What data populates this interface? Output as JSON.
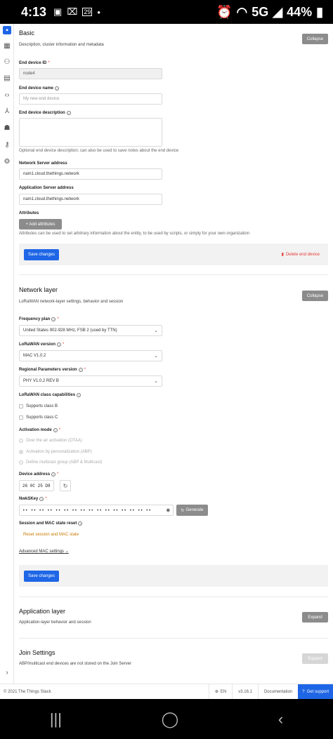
{
  "status_bar": {
    "time": "4:13",
    "network": "5G",
    "battery": "44%",
    "calendar_day": "29"
  },
  "sidebar": {
    "expand_icon": "chevron-right"
  },
  "basic": {
    "title": "Basic",
    "description": "Description, cluster information and metadata",
    "collapse_label": "Collapse",
    "end_device_id": {
      "label": "End device ID",
      "value": "node4"
    },
    "end_device_name": {
      "label": "End device name",
      "placeholder": "My new end device"
    },
    "end_device_description": {
      "label": "End device description",
      "hint": "Optional end device description; can also be used to save notes about the end device"
    },
    "network_server_address": {
      "label": "Network Server address",
      "value": "nam1.cloud.thethings.network"
    },
    "application_server_address": {
      "label": "Application Server address",
      "value": "nam1.cloud.thethings.network"
    },
    "attributes": {
      "label": "Attributes",
      "add_label": "+ Add attributes",
      "hint": "Attributes can be used to set arbitrary information about the entity, to be used by scripts, or simply for your own organization"
    },
    "save_label": "Save changes",
    "delete_label": "Delete end device"
  },
  "network": {
    "title": "Network layer",
    "description": "LoRaWAN network-layer settings, behavior and session",
    "collapse_label": "Collapse",
    "frequency_plan": {
      "label": "Frequency plan",
      "value": "United States 902-928 MHz, FSB 2 (used by TTN)"
    },
    "lorawan_version": {
      "label": "LoRaWAN version",
      "value": "MAC V1.0.2"
    },
    "regional_params": {
      "label": "Regional Parameters version",
      "value": "PHY V1.0.2 REV B"
    },
    "class_capabilities": {
      "label": "LoRaWAN class capabilities",
      "class_b": "Supports class B",
      "class_c": "Supports class C"
    },
    "activation_mode": {
      "label": "Activation mode",
      "options": [
        "Over the air activation (OTAA)",
        "Activation by personalization (ABP)",
        "Define multicast group (ABP & Multicast)"
      ]
    },
    "device_address": {
      "label": "Device address",
      "value": "26 0C 25 D8"
    },
    "nwkskey": {
      "label": "NwkSKey",
      "value": "•• •• •• •• •• •• •• •• •• •• •• •• •• •• •• ••",
      "generate_label": "Generate"
    },
    "session_reset": {
      "label": "Session and MAC state reset",
      "link": "Reset session and MAC state"
    },
    "advanced_label": "Advanced MAC settings",
    "save_label": "Save changes"
  },
  "application": {
    "title": "Application layer",
    "description": "Application-layer behavior and session",
    "expand_label": "Expand"
  },
  "join": {
    "title": "Join Settings",
    "description": "ABP/multicast end devices are not stored on the Join Server",
    "expand_label": "Expand"
  },
  "footer": {
    "copyright": "© 2021 The Things Stack",
    "language": "EN",
    "version": "v3.16.1",
    "docs": "Documentation",
    "support": "Get support"
  }
}
